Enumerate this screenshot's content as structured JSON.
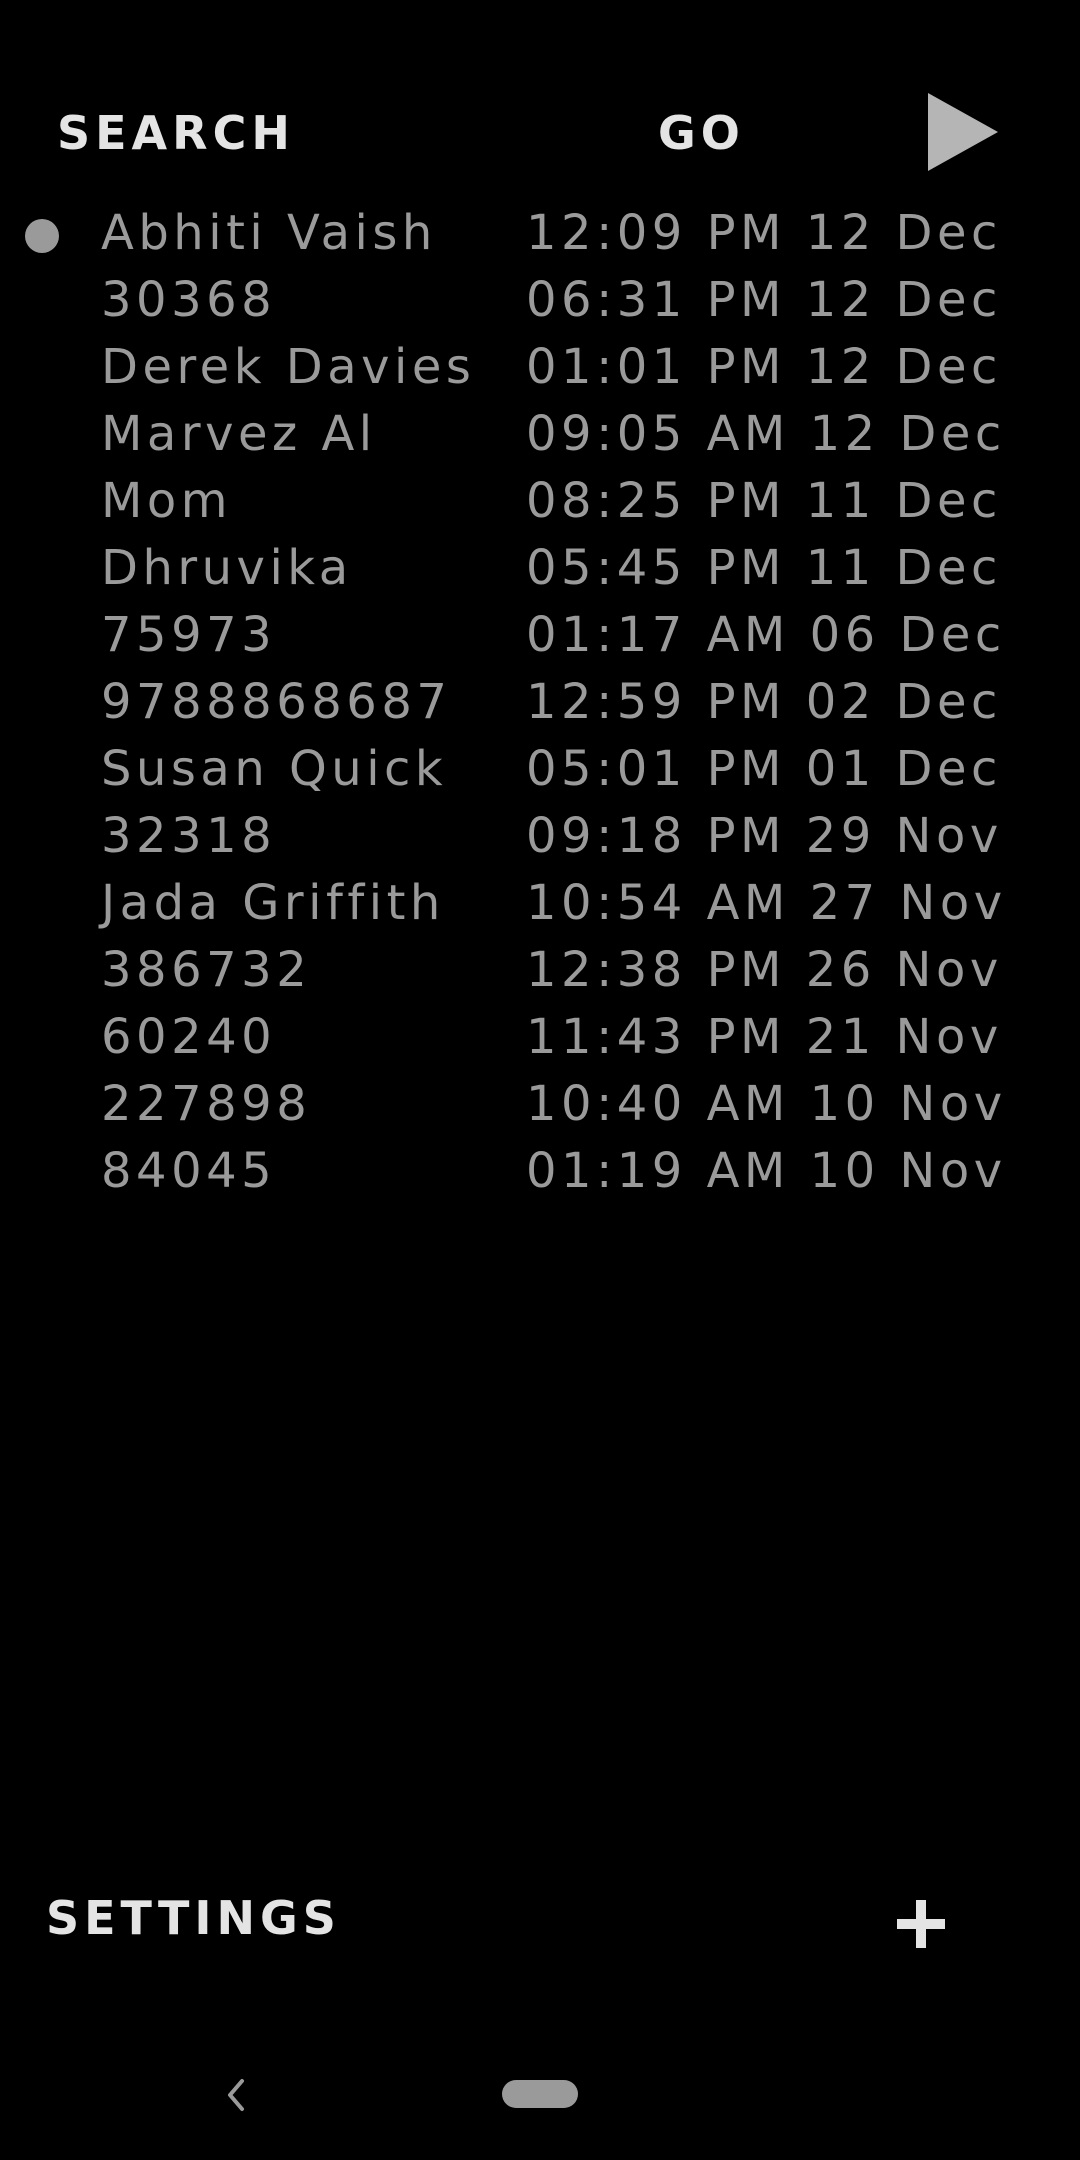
{
  "header": {
    "search_label": "SEARCH",
    "go_label": "GO",
    "play_icon": "play-icon"
  },
  "calls": [
    {
      "name": "Abhiti Vaish",
      "time": "12:09 PM 12 Dec",
      "unread": true
    },
    {
      "name": "30368",
      "time": "06:31 PM 12 Dec",
      "unread": false
    },
    {
      "name": "Derek Davies",
      "time": "01:01 PM 12 Dec",
      "unread": false
    },
    {
      "name": "Marvez Al",
      "time": "09:05 AM 12 Dec",
      "unread": false
    },
    {
      "name": "Mom",
      "time": "08:25 PM 11 Dec",
      "unread": false
    },
    {
      "name": "Dhruvika",
      "time": "05:45 PM 11 Dec",
      "unread": false
    },
    {
      "name": "75973",
      "time": "01:17 AM 06 Dec",
      "unread": false
    },
    {
      "name": "9788868687",
      "time": "12:59 PM 02 Dec",
      "unread": false
    },
    {
      "name": "Susan Quick",
      "time": "05:01 PM 01 Dec",
      "unread": false
    },
    {
      "name": "32318",
      "time": "09:18 PM 29 Nov",
      "unread": false
    },
    {
      "name": "Jada Griffith",
      "time": "10:54 AM 27 Nov",
      "unread": false
    },
    {
      "name": "386732",
      "time": "12:38 PM 26 Nov",
      "unread": false
    },
    {
      "name": "60240",
      "time": "11:43 PM 21 Nov",
      "unread": false
    },
    {
      "name": "227898",
      "time": "10:40 AM 10 Nov",
      "unread": false
    },
    {
      "name": "84045",
      "time": "01:19 AM 10 Nov",
      "unread": false
    }
  ],
  "footer": {
    "settings_label": "SETTINGS",
    "add_icon": "plus-icon"
  },
  "nav": {
    "back_icon": "chevron-left-icon",
    "home_icon": "home-pill-icon"
  },
  "colors": {
    "background": "#000000",
    "text_muted": "#9a9a9a",
    "text_bright": "#e4e4e4"
  }
}
